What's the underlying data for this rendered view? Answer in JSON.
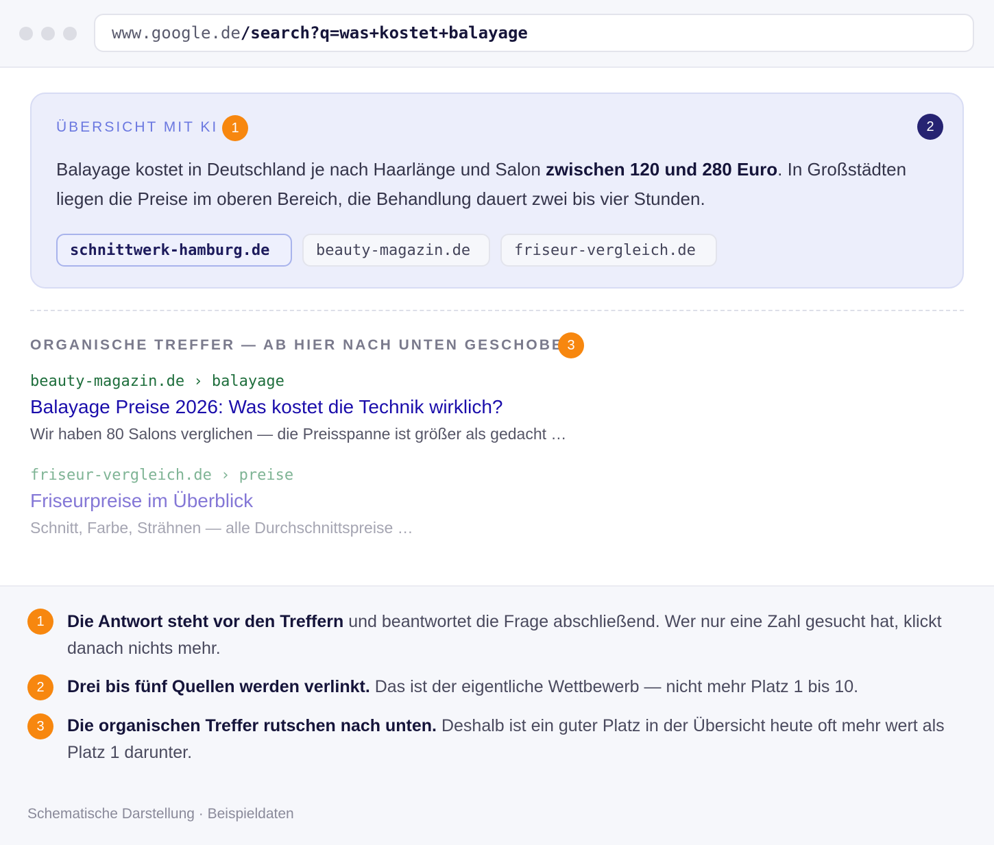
{
  "browser": {
    "url_host": "www.google.de",
    "url_path": "/search?q=was+kostet+balayage"
  },
  "ai_overview": {
    "label": "ÜBERSICHT MIT KI",
    "badge_label": "1",
    "corner_badge": "2",
    "text_before": "Balayage kostet in Deutschland je nach Haarlänge und Salon ",
    "text_bold": "zwischen 120 und 280 Euro",
    "text_after": ". In Großstädten liegen die Preise im oberen Bereich, die Behandlung dauert zwei bis vier Stunden.",
    "sources": [
      "schnittwerk-hamburg.de",
      "beauty-magazin.de",
      "friseur-vergleich.de"
    ]
  },
  "organic": {
    "label": "ORGANISCHE TREFFER — AB HIER NACH UNTEN GESCHOBEN",
    "badge": "3",
    "results": [
      {
        "url": "beauty-magazin.de › balayage",
        "title": "Balayage Preise 2026: Was kostet die Technik wirklich?",
        "snippet": "Wir haben 80 Salons verglichen — die Preisspanne ist größer als gedacht …"
      },
      {
        "url": "friseur-vergleich.de › preise",
        "title": "Friseurpreise im Überblick",
        "snippet": "Schnitt, Farbe, Strähnen — alle Durchschnittspreise …"
      }
    ]
  },
  "notes": [
    {
      "num": "1",
      "bold": "Die Antwort steht vor den Treffern",
      "text": " und beantwortet die Frage abschließend. Wer nur eine Zahl gesucht hat, klickt danach nichts mehr."
    },
    {
      "num": "2",
      "bold": "Drei bis fünf Quellen werden verlinkt.",
      "text": " Das ist der eigentliche Wettbewerb — nicht mehr Platz 1 bis 10."
    },
    {
      "num": "3",
      "bold": "Die organischen Treffer rutschen nach unten.",
      "text": " Deshalb ist ein guter Platz in der Übersicht heute oft mehr wert als Platz 1 darunter."
    }
  ],
  "footer": "Schematische Darstellung · Beispieldaten",
  "colors": {
    "accent_orange": "#f7870f",
    "accent_navy": "#262372",
    "ai_background": "#eceefb",
    "result_title": "#1a0dab",
    "result_url": "#1e6e3c"
  }
}
